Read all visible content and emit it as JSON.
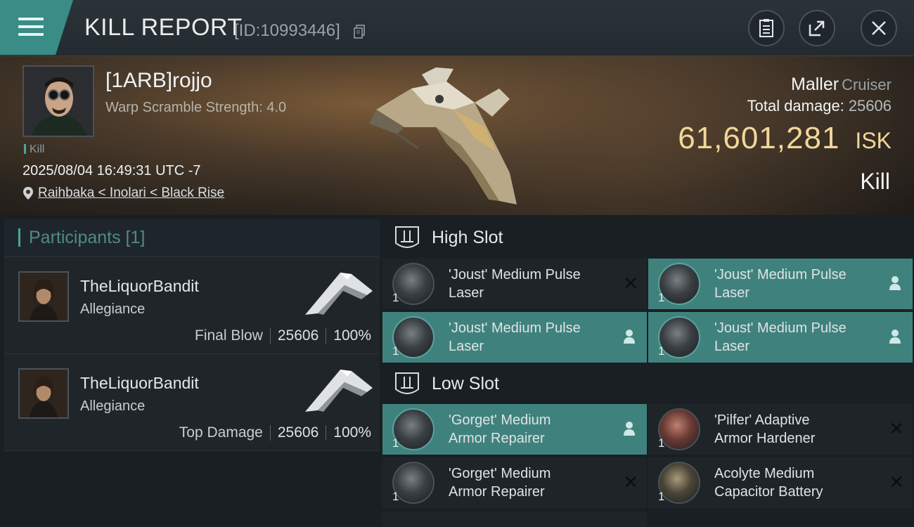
{
  "header": {
    "title": "KILL REPORT",
    "id_text": "[ID:10993446]"
  },
  "victim": {
    "name": "[1ARB]rojjo",
    "warp_text": "Warp Scramble Strength: 4.0",
    "kill_tag": "Kill",
    "datetime": "2025/08/04 16:49:31 UTC -7",
    "location": "Raihbaka < Inolari < Black Rise",
    "ship": "Maller",
    "ship_class": "Cruiser",
    "total_damage_label": "Total damage:",
    "total_damage": "25606",
    "isk_value": "61,601,281",
    "isk_unit": "ISK",
    "result": "Kill"
  },
  "participants": {
    "title": "Participants [1]",
    "rows": [
      {
        "name": "TheLiquorBandit",
        "corp": "Allegiance",
        "role": "Final Blow",
        "damage": "25606",
        "percent": "100%"
      },
      {
        "name": "TheLiquorBandit",
        "corp": "Allegiance",
        "role": "Top Damage",
        "damage": "25606",
        "percent": "100%"
      }
    ]
  },
  "slots": {
    "high": {
      "title": "High Slot",
      "modules": [
        {
          "line1": "'Joust' Medium Pulse",
          "line2": "Laser",
          "qty": "1",
          "state": "destroyed"
        },
        {
          "line1": "'Joust' Medium Pulse",
          "line2": "Laser",
          "qty": "1",
          "state": "dropped"
        },
        {
          "line1": "'Joust' Medium Pulse",
          "line2": "Laser",
          "qty": "1",
          "state": "dropped"
        },
        {
          "line1": "'Joust' Medium Pulse",
          "line2": "Laser",
          "qty": "1",
          "state": "dropped"
        }
      ]
    },
    "low": {
      "title": "Low Slot",
      "modules": [
        {
          "line1": "'Gorget' Medium",
          "line2": "Armor Repairer",
          "qty": "1",
          "state": "dropped"
        },
        {
          "line1": "'Pilfer' Adaptive",
          "line2": "Armor Hardener",
          "qty": "1",
          "state": "destroyed"
        },
        {
          "line1": "'Gorget' Medium",
          "line2": "Armor Repairer",
          "qty": "1",
          "state": "destroyed"
        },
        {
          "line1": "Acolyte Medium",
          "line2": "Capacitor Battery",
          "qty": "1",
          "state": "destroyed"
        }
      ]
    }
  },
  "colors": {
    "accent_teal": "#3f827d",
    "isk_gold": "#f2d79a",
    "panel_bg": "#1e2428"
  },
  "icons": [
    "menu-icon",
    "copy-icon",
    "clipboard-icon",
    "share-icon",
    "close-icon",
    "location-pin-icon",
    "slot-icon",
    "person-icon",
    "close-x-icon"
  ]
}
